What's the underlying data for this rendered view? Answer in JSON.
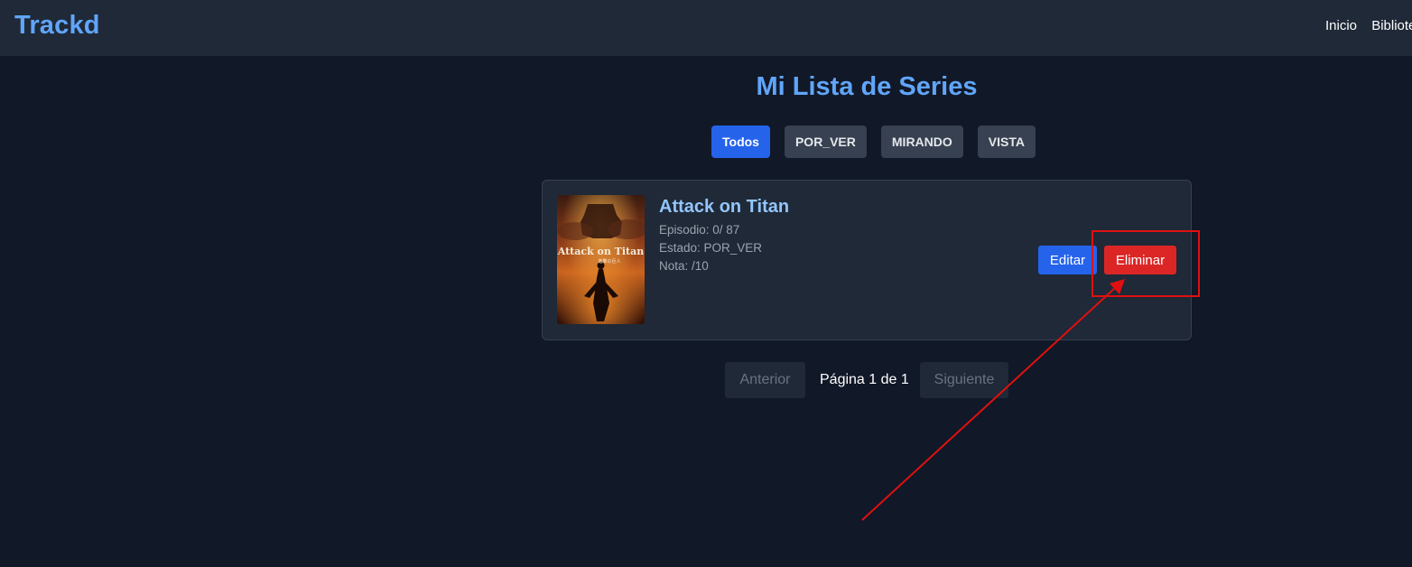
{
  "header": {
    "brand": "Trackd",
    "nav": [
      "Inicio",
      "Biblioteca"
    ]
  },
  "page": {
    "title": "Mi Lista de Series"
  },
  "filters": [
    {
      "label": "Todos",
      "active": true
    },
    {
      "label": "POR_VER",
      "active": false
    },
    {
      "label": "MIRANDO",
      "active": false
    },
    {
      "label": "VISTA",
      "active": false
    }
  ],
  "series": [
    {
      "title": "Attack on Titan",
      "episode_text": "Episodio: 0/ 87",
      "status_text": "Estado: POR_VER",
      "rating_text": "Nota: /10",
      "poster_text": "Attack on Titan",
      "poster_subtext": "進撃の巨人",
      "edit_label": "Editar",
      "delete_label": "Eliminar"
    }
  ],
  "pagination": {
    "prev_label": "Anterior",
    "info": "Página 1 de 1",
    "next_label": "Siguiente"
  },
  "colors": {
    "background": "#111827",
    "header": "#1f2937",
    "accent": "#60a5fa",
    "primary": "#2563eb",
    "danger": "#dc2626",
    "annotation": "#e01010"
  }
}
